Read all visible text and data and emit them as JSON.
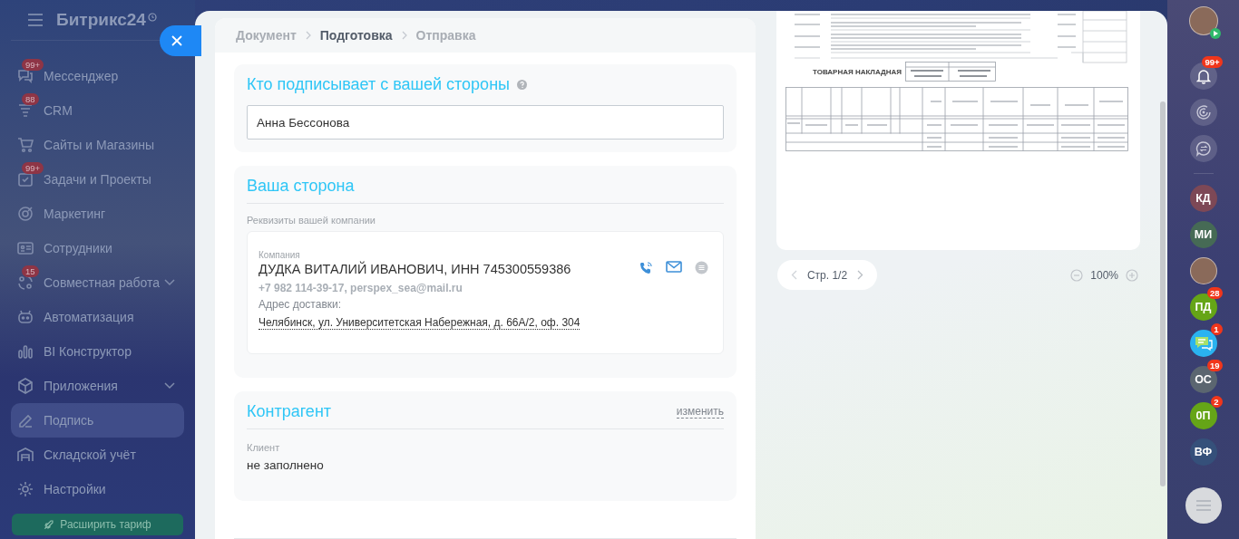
{
  "sidebar": {
    "logo": "Битрикс24",
    "items": [
      {
        "label": "Мессенджер",
        "badge": "99+",
        "expandable": false,
        "selected": false
      },
      {
        "label": "CRM",
        "badge": "88",
        "expandable": false,
        "selected": false
      },
      {
        "label": "Сайты и Магазины",
        "expandable": false,
        "selected": false
      },
      {
        "label": "Задачи и Проекты",
        "badge": "99+",
        "expandable": false,
        "selected": false
      },
      {
        "label": "Маркетинг",
        "expandable": false,
        "selected": false
      },
      {
        "label": "Сотрудники",
        "expandable": false,
        "selected": false
      },
      {
        "label": "Совместная работа",
        "badge": "15",
        "expandable": true,
        "selected": false
      },
      {
        "label": "Автоматизация",
        "expandable": false,
        "selected": false
      },
      {
        "label": "BI Конструктор",
        "expandable": false,
        "selected": false
      },
      {
        "label": "Приложения",
        "expandable": true,
        "selected": false
      },
      {
        "label": "Подпись",
        "expandable": false,
        "selected": true
      },
      {
        "label": "Складской учёт",
        "expandable": false,
        "selected": false
      },
      {
        "label": "Настройки",
        "expandable": false,
        "selected": false
      }
    ],
    "upgrade_button": "Расширить тариф"
  },
  "steps": [
    {
      "label": "Документ",
      "selected": false
    },
    {
      "label": "Подготовка",
      "selected": true
    },
    {
      "label": "Отправка",
      "selected": false
    }
  ],
  "signer": {
    "title": "Кто подписывает с вашей стороны",
    "value": "Анна Бессонова"
  },
  "our_side": {
    "title": "Ваша сторона",
    "subtitle": "Реквизиты вашей компании",
    "company": {
      "label": "Компания",
      "name": "ДУДКА ВИТАЛИЙ ИВАНОВИЧ, ИНН 745300559386",
      "contacts": "+7 982 114-39-17, perspex_sea@mail.ru",
      "address_label": "Адрес доставки:",
      "address": "Челябинск, ул. Университетская Набережная, д. 66А/2, оф. 304"
    }
  },
  "counterparty": {
    "title": "Контрагент",
    "action": "изменить",
    "label": "Клиент",
    "value": "не заполнено"
  },
  "preview": {
    "document_title": "ТОВАРНАЯ НАКЛАДНАЯ",
    "page": "Стр. 1/2",
    "zoom": "100%"
  },
  "right_bar": [
    {
      "kind": "photo"
    },
    {
      "kind": "bell",
      "badge": "99+"
    },
    {
      "kind": "target"
    },
    {
      "kind": "swap"
    },
    {
      "kind": "initials",
      "text": "КД",
      "color": "#7d4856"
    },
    {
      "kind": "initials",
      "text": "МИ",
      "color": "#466a55"
    },
    {
      "kind": "photo"
    },
    {
      "kind": "initials",
      "text": "ПД",
      "color": "#65a517",
      "badge": "28"
    },
    {
      "kind": "chat",
      "badge": "1"
    },
    {
      "kind": "initials",
      "text": "ОС",
      "color": "#5b6670",
      "badge": "19"
    },
    {
      "kind": "initials",
      "text": "0П",
      "color": "#65a517",
      "badge": "2"
    },
    {
      "kind": "initials",
      "text": "ВФ",
      "color": "#35507a"
    }
  ]
}
